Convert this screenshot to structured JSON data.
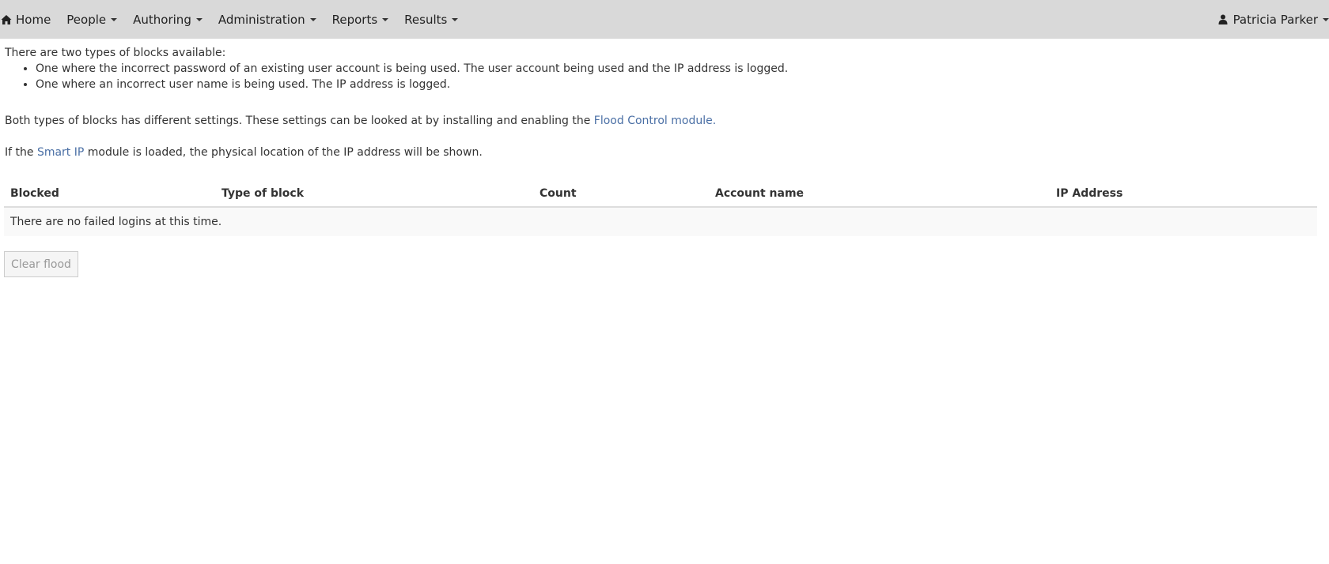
{
  "navbar": {
    "items": [
      {
        "label": "Home",
        "icon": "home-icon"
      },
      {
        "label": "People"
      },
      {
        "label": "Authoring"
      },
      {
        "label": "Administration"
      },
      {
        "label": "Reports"
      },
      {
        "label": "Results"
      }
    ],
    "user": {
      "name": "Patricia Parker",
      "icon": "user-icon"
    }
  },
  "content": {
    "intro": "There are two types of blocks available:",
    "types": [
      "One where the incorrect password of an existing user account is being used. The user account being used and the IP address is logged.",
      "One where an incorrect user name is being used. The IP address is logged."
    ],
    "para1_prefix": "Both types of blocks has different settings. These settings can be looked at by installing and enabling the ",
    "para1_link": "Flood Control module.",
    "para2_prefix": "If the ",
    "para2_link": "Smart IP",
    "para2_suffix": " module is loaded, the physical location of the IP address will be shown."
  },
  "table": {
    "headers": [
      "Blocked",
      "Type of block",
      "Count",
      "Account name",
      "IP Address"
    ],
    "empty_message": "There are no failed logins at this time."
  },
  "actions": {
    "clear_label": "Clear flood"
  },
  "colors": {
    "navbar_bg": "#d9d9d9",
    "link": "#4a6fa5"
  }
}
